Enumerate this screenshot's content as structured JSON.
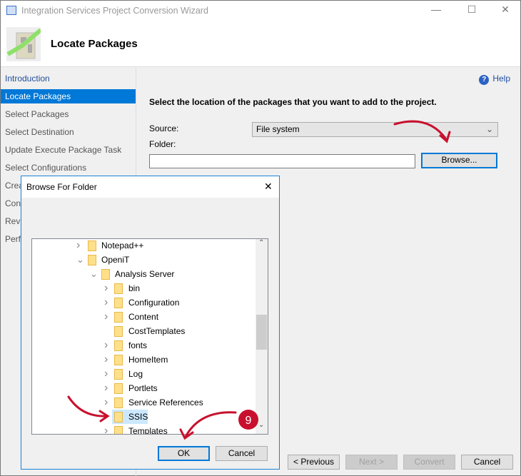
{
  "window": {
    "title": "Integration Services Project Conversion Wizard",
    "minimize": "—",
    "maximize": "☐",
    "close": "✕"
  },
  "header": {
    "title": "Locate Packages"
  },
  "sidebar": {
    "items": [
      {
        "label": "Introduction",
        "selected": false
      },
      {
        "label": "Locate Packages",
        "selected": true
      },
      {
        "label": "Select Packages",
        "selected": false
      },
      {
        "label": "Select Destination",
        "selected": false
      },
      {
        "label": "Update Execute Package Task",
        "selected": false
      },
      {
        "label": "Select Configurations",
        "selected": false
      },
      {
        "label": "Crea",
        "selected": false
      },
      {
        "label": "Conf",
        "selected": false
      },
      {
        "label": "Revi",
        "selected": false
      },
      {
        "label": "Perfo",
        "selected": false
      }
    ]
  },
  "main": {
    "help": "Help",
    "instruction": "Select the location of the packages that you want to add to the project.",
    "source_label": "Source:",
    "source_value": "File system",
    "folder_label": "Folder:",
    "folder_value": "",
    "browse": "Browse..."
  },
  "footer": {
    "previous": "< Previous",
    "next": "Next >",
    "convert": "Convert",
    "cancel": "Cancel"
  },
  "dialog": {
    "title": "Browse For Folder",
    "close": "✕",
    "ok": "OK",
    "cancel": "Cancel",
    "tree": [
      {
        "label": "Notepad++",
        "level": 0,
        "state": "collapsed"
      },
      {
        "label": "OpeniT",
        "level": 0,
        "state": "expanded"
      },
      {
        "label": "Analysis Server",
        "level": 1,
        "state": "expanded"
      },
      {
        "label": "bin",
        "level": 2,
        "state": "collapsed"
      },
      {
        "label": "Configuration",
        "level": 2,
        "state": "collapsed"
      },
      {
        "label": "Content",
        "level": 2,
        "state": "collapsed"
      },
      {
        "label": "CostTemplates",
        "level": 2,
        "state": "leaf"
      },
      {
        "label": "fonts",
        "level": 2,
        "state": "collapsed"
      },
      {
        "label": "HomeItem",
        "level": 2,
        "state": "collapsed"
      },
      {
        "label": "Log",
        "level": 2,
        "state": "collapsed"
      },
      {
        "label": "Portlets",
        "level": 2,
        "state": "collapsed"
      },
      {
        "label": "Service References",
        "level": 2,
        "state": "collapsed"
      },
      {
        "label": "SSIS",
        "level": 2,
        "state": "leaf",
        "selected": true
      },
      {
        "label": "Templates",
        "level": 2,
        "state": "collapsed"
      }
    ]
  },
  "annotation": {
    "step": "9",
    "color": "#c8102e"
  }
}
